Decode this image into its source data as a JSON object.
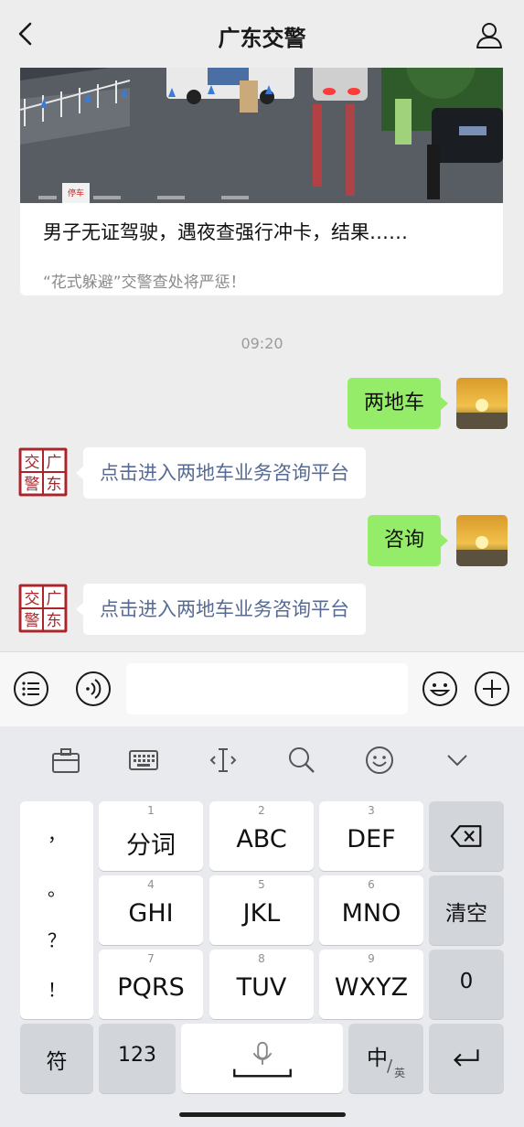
{
  "header": {
    "title": "广东交警"
  },
  "article": {
    "headline": "男子无证驾驶，遇夜查强行冲卡，结果……",
    "subtitle": "“花式躲避”交警查处将严惩！",
    "photo_sign": "停车"
  },
  "timestamp": "09:20",
  "messages": [
    {
      "from": "me",
      "text": "两地车"
    },
    {
      "from": "bot",
      "text": "点击进入两地车业务咨询平台",
      "avatar_chars": [
        "交",
        "广",
        "警",
        "东"
      ]
    },
    {
      "from": "me",
      "text": "咨询"
    },
    {
      "from": "bot",
      "text": "点击进入两地车业务咨询平台",
      "avatar_chars": [
        "交",
        "广",
        "警",
        "东"
      ]
    }
  ],
  "input": {
    "value": "",
    "placeholder": ""
  },
  "keyboard": {
    "punctuation": [
      "，",
      "。",
      "？",
      "！"
    ],
    "keys": [
      {
        "num": "1",
        "label": "分词"
      },
      {
        "num": "2",
        "label": "ABC"
      },
      {
        "num": "3",
        "label": "DEF"
      },
      {
        "num": "4",
        "label": "GHI"
      },
      {
        "num": "5",
        "label": "JKL"
      },
      {
        "num": "6",
        "label": "MNO"
      },
      {
        "num": "7",
        "label": "PQRS"
      },
      {
        "num": "8",
        "label": "TUV"
      },
      {
        "num": "9",
        "label": "WXYZ"
      }
    ],
    "clear_label": "清空",
    "zero_label": "0",
    "symbol_label": "符",
    "numeric_label": "123",
    "lang_main": "中",
    "lang_alt": "英"
  },
  "colors": {
    "outgoing_bubble": "#95ec69",
    "link_text": "#576b95",
    "seal_red": "#a8252b"
  }
}
